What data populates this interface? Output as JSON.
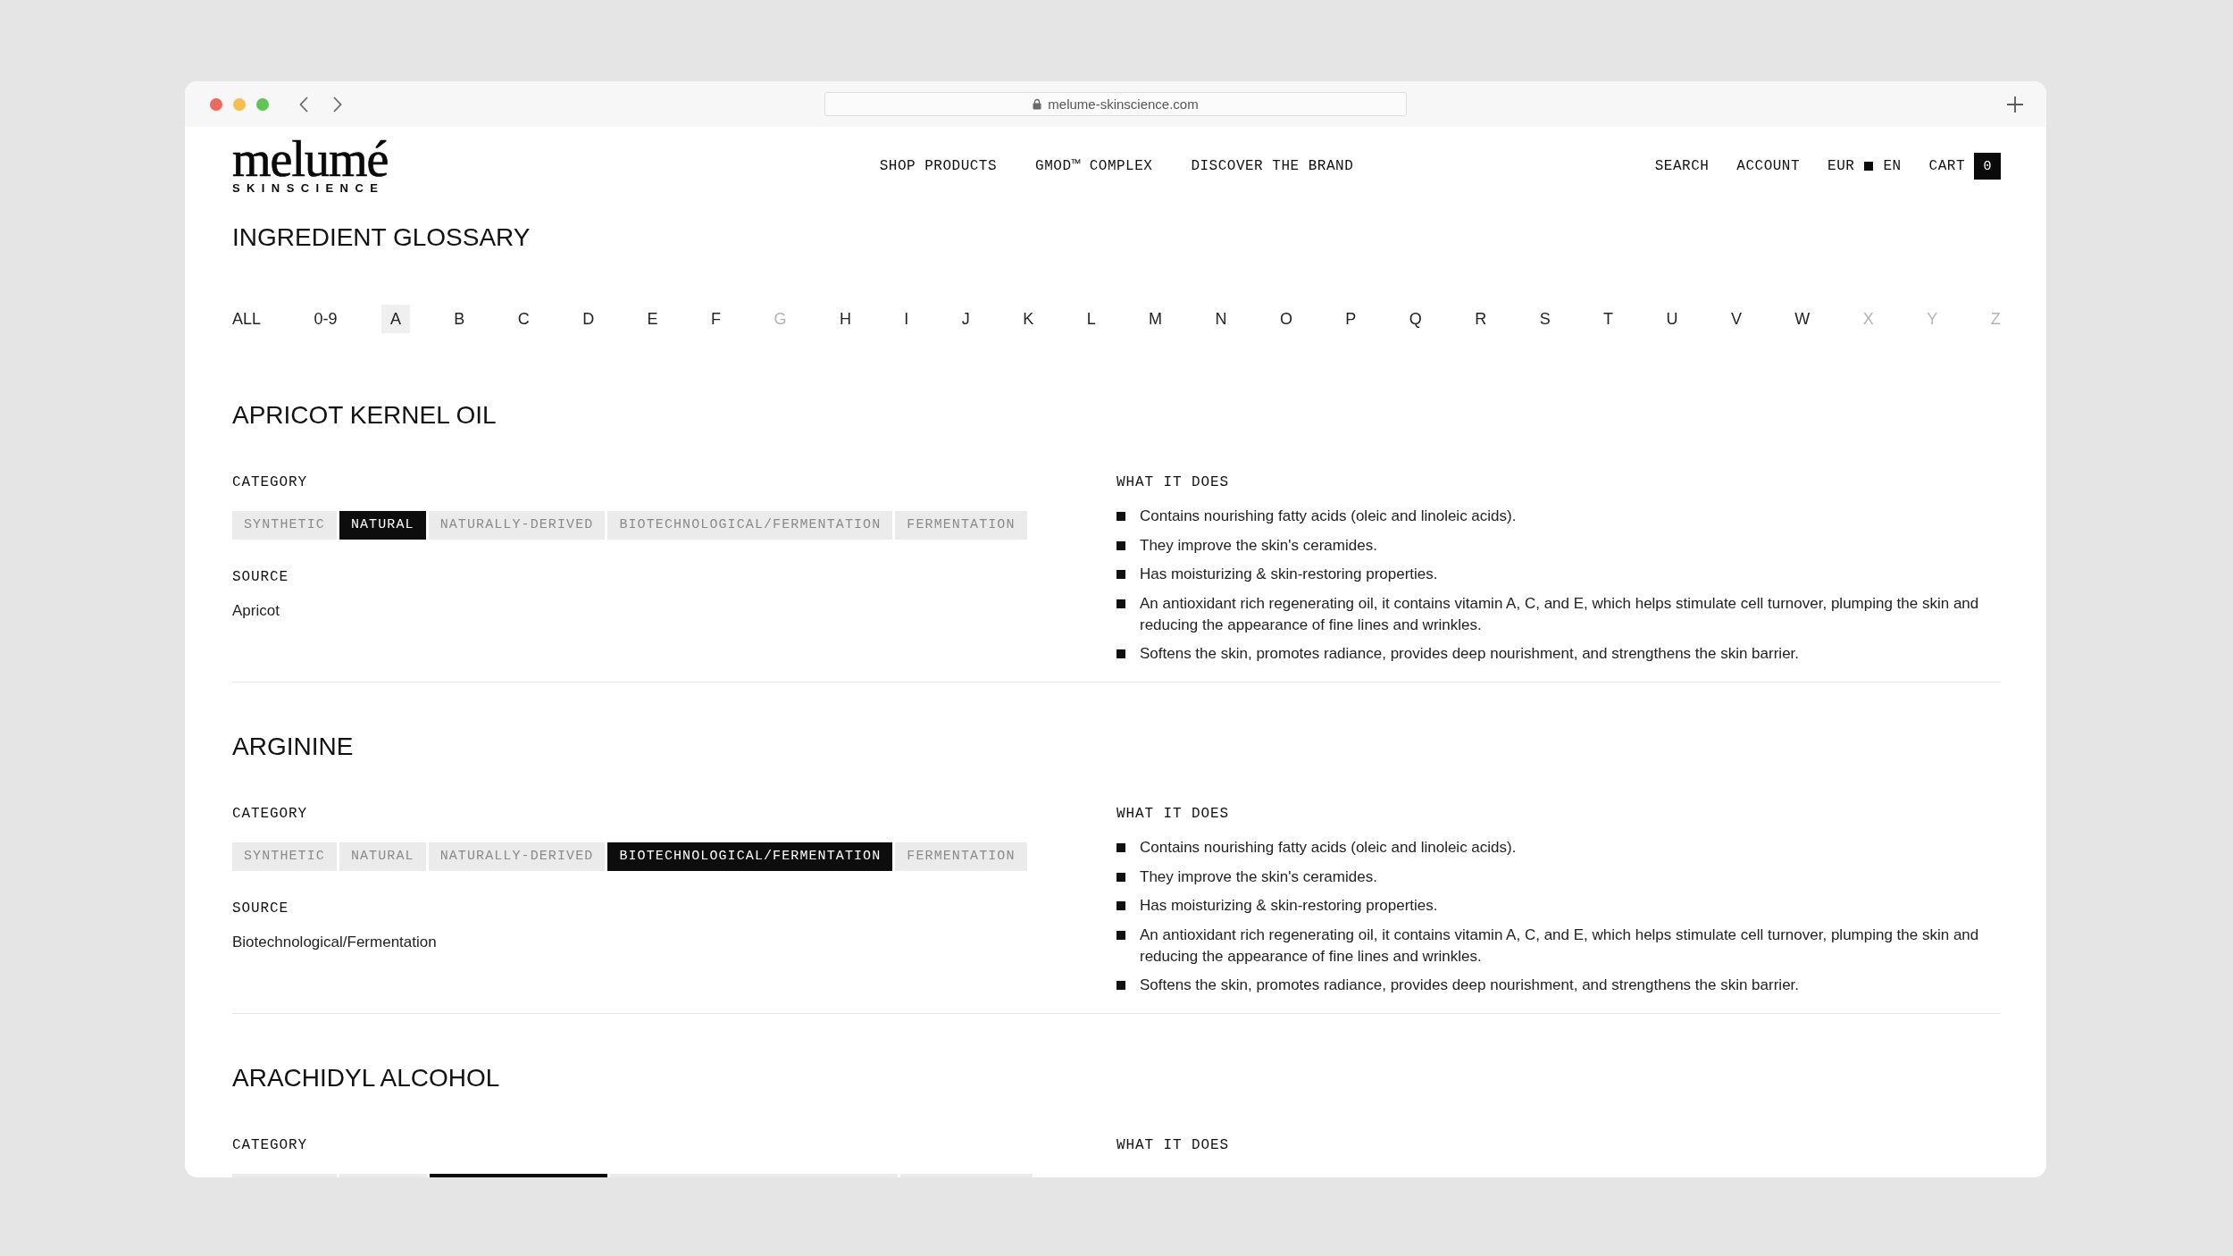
{
  "browser": {
    "url": "melume-skinscience.com"
  },
  "header": {
    "logo": {
      "wordmark": "melumé",
      "tagline": "SKINSCIENCE"
    },
    "nav": [
      "SHOP PRODUCTS",
      "GMOD™ COMPLEX",
      "DISCOVER THE BRAND"
    ],
    "search": "SEARCH",
    "account": "ACCOUNT",
    "currency": "EUR",
    "language": "EN",
    "cart": "CART",
    "cart_count": "0"
  },
  "page_title": "INGREDIENT GLOSSARY",
  "alphabet": [
    {
      "label": "ALL",
      "selected": false,
      "disabled": false
    },
    {
      "label": "0-9",
      "selected": false,
      "disabled": false
    },
    {
      "label": "A",
      "selected": true,
      "disabled": false
    },
    {
      "label": "B",
      "selected": false,
      "disabled": false
    },
    {
      "label": "C",
      "selected": false,
      "disabled": false
    },
    {
      "label": "D",
      "selected": false,
      "disabled": false
    },
    {
      "label": "E",
      "selected": false,
      "disabled": false
    },
    {
      "label": "F",
      "selected": false,
      "disabled": false
    },
    {
      "label": "G",
      "selected": false,
      "disabled": true
    },
    {
      "label": "H",
      "selected": false,
      "disabled": false
    },
    {
      "label": "I",
      "selected": false,
      "disabled": false
    },
    {
      "label": "J",
      "selected": false,
      "disabled": false
    },
    {
      "label": "K",
      "selected": false,
      "disabled": false
    },
    {
      "label": "L",
      "selected": false,
      "disabled": false
    },
    {
      "label": "M",
      "selected": false,
      "disabled": false
    },
    {
      "label": "N",
      "selected": false,
      "disabled": false
    },
    {
      "label": "O",
      "selected": false,
      "disabled": false
    },
    {
      "label": "P",
      "selected": false,
      "disabled": false
    },
    {
      "label": "Q",
      "selected": false,
      "disabled": false
    },
    {
      "label": "R",
      "selected": false,
      "disabled": false
    },
    {
      "label": "S",
      "selected": false,
      "disabled": false
    },
    {
      "label": "T",
      "selected": false,
      "disabled": false
    },
    {
      "label": "U",
      "selected": false,
      "disabled": false
    },
    {
      "label": "V",
      "selected": false,
      "disabled": false
    },
    {
      "label": "W",
      "selected": false,
      "disabled": false
    },
    {
      "label": "X",
      "selected": false,
      "disabled": true
    },
    {
      "label": "Y",
      "selected": false,
      "disabled": true
    },
    {
      "label": "Z",
      "selected": false,
      "disabled": true
    }
  ],
  "ingredients": [
    {
      "name": "APRICOT KERNEL OIL",
      "category_label": "CATEGORY",
      "categories": [
        {
          "label": "SYNTHETIC",
          "selected": false
        },
        {
          "label": "NATURAL",
          "selected": true
        },
        {
          "label": "NATURALLY-DERIVED",
          "selected": false
        },
        {
          "label": "BIOTECHNOLOGICAL/FERMENTATION",
          "selected": false
        },
        {
          "label": "FERMENTATION",
          "selected": false
        }
      ],
      "source_label": "SOURCE",
      "source": "Apricot",
      "benefits_label": "WHAT IT DOES",
      "benefits": [
        "Contains nourishing fatty acids (oleic and linoleic acids).",
        "They improve the skin's ceramides.",
        "Has moisturizing & skin-restoring properties.",
        "An antioxidant rich regenerating oil, it contains vitamin A, C, and E, which helps stimulate cell turnover, plumping the skin and reducing the appearance of fine lines and wrinkles.",
        "Softens the skin, promotes radiance, provides deep nourishment, and strengthens the skin barrier."
      ]
    },
    {
      "name": "ARGININE",
      "category_label": "CATEGORY",
      "categories": [
        {
          "label": "SYNTHETIC",
          "selected": false
        },
        {
          "label": "NATURAL",
          "selected": false
        },
        {
          "label": "NATURALLY-DERIVED",
          "selected": false
        },
        {
          "label": "BIOTECHNOLOGICAL/FERMENTATION",
          "selected": true
        },
        {
          "label": "FERMENTATION",
          "selected": false
        }
      ],
      "source_label": "SOURCE",
      "source": "Biotechnological/Fermentation",
      "benefits_label": "WHAT IT DOES",
      "benefits": [
        "Contains nourishing fatty acids (oleic and linoleic acids).",
        "They improve the skin's ceramides.",
        "Has moisturizing & skin-restoring properties.",
        "An antioxidant rich regenerating oil, it contains vitamin A, C, and E, which helps stimulate cell turnover, plumping the skin and reducing the appearance of fine lines and wrinkles.",
        "Softens the skin, promotes radiance, provides deep nourishment, and strengthens the skin barrier."
      ]
    },
    {
      "name": "ARACHIDYL ALCOHOL",
      "category_label": "CATEGORY",
      "categories": [
        {
          "selected": false
        },
        {
          "selected": false
        },
        {
          "selected": true
        },
        {
          "selected": false
        },
        {
          "selected": false
        }
      ],
      "benefits_label": "WHAT IT DOES"
    }
  ]
}
